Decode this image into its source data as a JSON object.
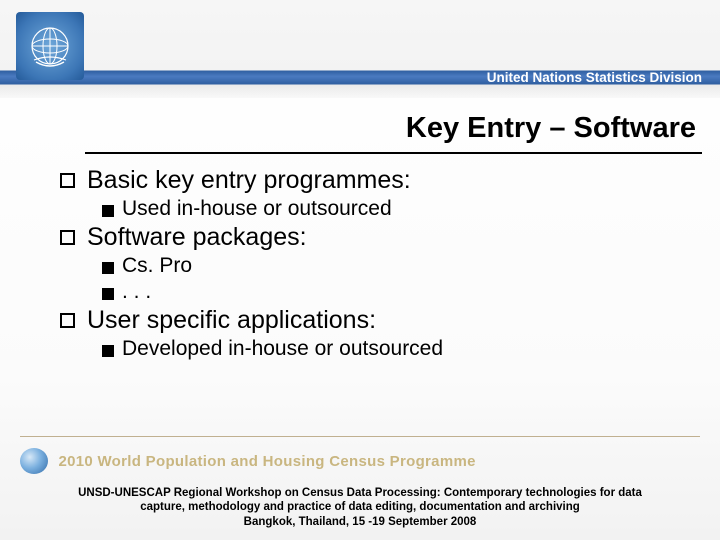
{
  "header": {
    "org_label": "United Nations Statistics Division"
  },
  "title": "Key Entry – Software",
  "bullets": {
    "b1": "Basic key entry programmes:",
    "b1a": "Used in-house or outsourced",
    "b2": "Software packages:",
    "b2a": "Cs. Pro",
    "b2b": ". . .",
    "b3": "User specific applications:",
    "b3a": "Developed in-house or outsourced"
  },
  "census_band": "2010 World Population and Housing Census Programme",
  "footer": {
    "line1": "UNSD-UNESCAP Regional Workshop on Census Data Processing: Contemporary technologies for data",
    "line2": "capture, methodology and practice of data editing, documentation and archiving",
    "line3": "Bangkok, Thailand, 15 -19 September 2008"
  }
}
